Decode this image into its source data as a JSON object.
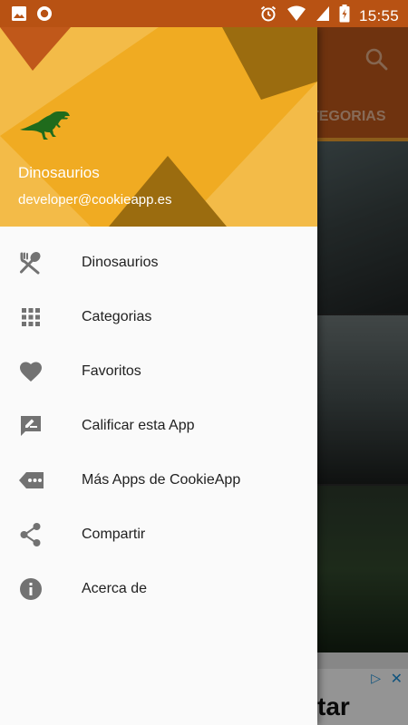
{
  "status_bar": {
    "time": "15:55",
    "left_icons": [
      "image-icon",
      "record-icon"
    ],
    "right_icons": [
      "alarm-icon",
      "wifi-icon",
      "battery-charging-icon"
    ]
  },
  "background": {
    "toolbar_color": "#c0581a",
    "tab_label": "CATEGORIAS",
    "tab_visible_text": "RIAS",
    "ad_text": "tar"
  },
  "drawer_header": {
    "name": "Dinosaurios",
    "email": "developer@cookieapp.es",
    "logo_icon": "dinosaur-icon",
    "colors": {
      "base": "#f0ab22",
      "light": "#f3bb48",
      "dark": "#9b6c0f",
      "orange": "#c0581a"
    }
  },
  "menu": {
    "items": [
      {
        "label": "Dinosaurios",
        "icon": "fork-spoon-icon"
      },
      {
        "label": "Categorias",
        "icon": "grid-icon"
      },
      {
        "label": "Favoritos",
        "icon": "heart-icon"
      },
      {
        "label": "Calificar esta App",
        "icon": "rate-review-icon"
      },
      {
        "label": "Más Apps de CookieApp",
        "icon": "more-tag-icon"
      },
      {
        "label": "Compartir",
        "icon": "share-icon"
      },
      {
        "label": "Acerca de",
        "icon": "info-icon"
      }
    ]
  }
}
